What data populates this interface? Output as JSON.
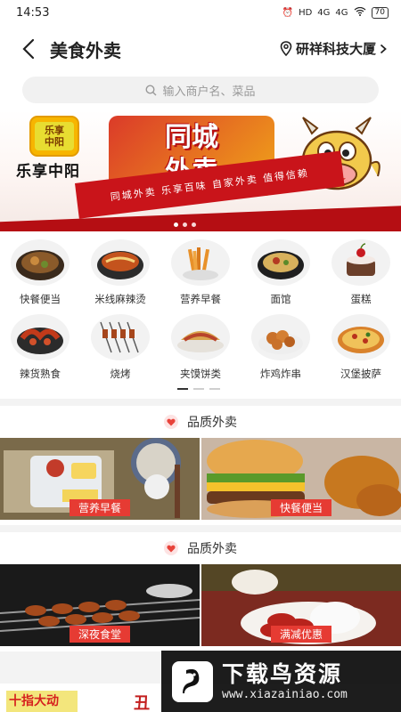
{
  "status_bar": {
    "time": "14:53",
    "network_1": "HD",
    "network_2": "4G",
    "network_3": "4G",
    "battery": "70"
  },
  "header": {
    "title": "美食外卖",
    "location": "研祥科技大厦"
  },
  "search": {
    "placeholder": "输入商户名、菜品"
  },
  "banner": {
    "brand_logo_line1": "乐享",
    "brand_logo_line2": "中阳",
    "brand_name": "乐享中阳",
    "title_line1": "同城",
    "title_line2": "外卖",
    "tagline": "同城外卖 乐享百味 自家外卖 值得信赖",
    "dots": 3,
    "active_dot": 1
  },
  "categories": [
    {
      "label": "快餐便当",
      "icon": "bento-icon"
    },
    {
      "label": "米线麻辣烫",
      "icon": "noodle-pot-icon"
    },
    {
      "label": "营养早餐",
      "icon": "fries-icon"
    },
    {
      "label": "面馆",
      "icon": "noodle-bowl-icon"
    },
    {
      "label": "蛋糕",
      "icon": "cake-icon"
    },
    {
      "label": "辣货熟食",
      "icon": "spicy-food-icon"
    },
    {
      "label": "烧烤",
      "icon": "bbq-icon"
    },
    {
      "label": "夹馍饼类",
      "icon": "flatbread-icon"
    },
    {
      "label": "炸鸡炸串",
      "icon": "fried-chicken-icon"
    },
    {
      "label": "汉堡披萨",
      "icon": "pizza-icon"
    }
  ],
  "sections": [
    {
      "title": "品质外卖",
      "promos": [
        {
          "label": "营养早餐",
          "image": "breakfast-image"
        },
        {
          "label": "快餐便当",
          "image": "burger-image"
        }
      ]
    },
    {
      "title": "品质外卖",
      "promos": [
        {
          "label": "深夜食堂",
          "image": "skewers-image"
        },
        {
          "label": "满减优惠",
          "image": "roast-duck-image"
        }
      ]
    }
  ],
  "teaser": {
    "left_text": "十指大动",
    "right_text": "丑"
  },
  "watermark": {
    "title": "下载鸟资源",
    "url": "www.xiazainiao.com"
  },
  "colors": {
    "accent_red": "#e63b33",
    "banner_red": "#c9141a",
    "search_bg": "#f1f1f1"
  }
}
